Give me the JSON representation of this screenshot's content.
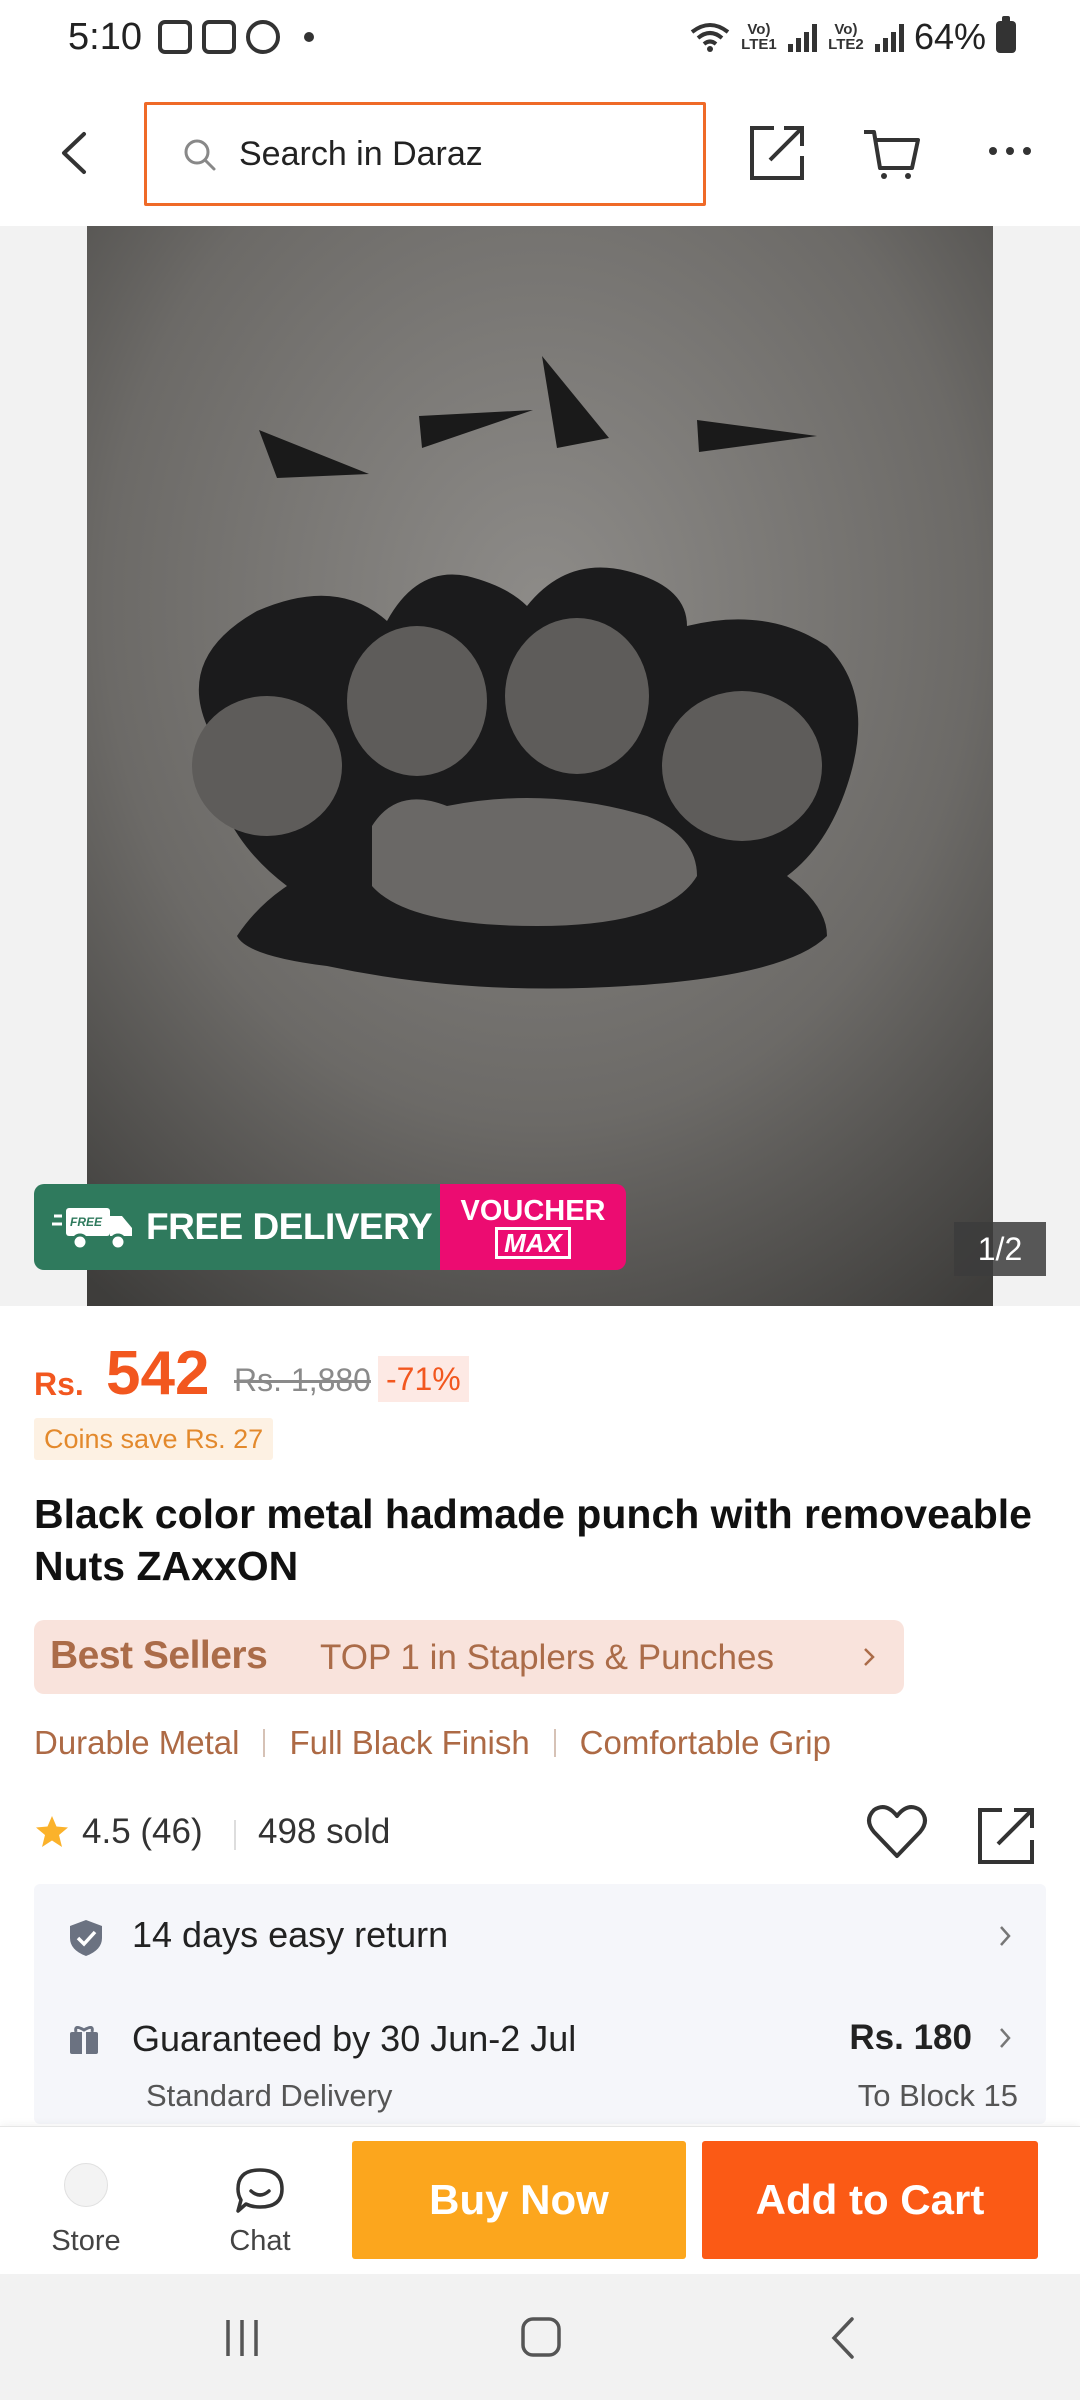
{
  "status_bar": {
    "time": "5:10",
    "lte1": "Vo) LTE1",
    "lte2": "Vo) LTE2",
    "battery": "64%"
  },
  "header": {
    "search_placeholder": "Search in Daraz",
    "icons": [
      "back-icon",
      "search-icon",
      "share-icon",
      "cart-icon",
      "more-icon"
    ]
  },
  "gallery": {
    "counter": "1/2",
    "promo": {
      "free_delivery": "FREE DELIVERY",
      "voucher_line1": "VOUCHER",
      "voucher_line2": "MAX"
    }
  },
  "price": {
    "currency": "Rs.",
    "current": "542",
    "original": "Rs. 1,880",
    "discount": "-71%",
    "coins_save": "Coins save Rs. 27"
  },
  "product": {
    "title": "Black color metal hadmade punch with removeable Nuts ZAxxON"
  },
  "bestsellers": {
    "logo": "Best Sellers",
    "rank": "TOP 1 in Staplers & Punches"
  },
  "features": [
    "Durable Metal",
    "Full Black Finish",
    "Comfortable Grip"
  ],
  "rating": {
    "score_text": "4.5 (46)",
    "sold": "498 sold"
  },
  "services": {
    "return": "14 days easy return",
    "guarantee": "Guaranteed by 30 Jun-2 Jul",
    "delivery_fee": "Rs. 180",
    "delivery_type": "Standard Delivery",
    "delivery_to": "To Block 15"
  },
  "bottom_bar": {
    "store": "Store",
    "chat": "Chat",
    "buy_now": "Buy Now",
    "add_to_cart": "Add to Cart"
  },
  "colors": {
    "accent_orange": "#f2571f",
    "buy_now": "#fca61d",
    "add_to_cart": "#fb5a15",
    "free_delivery_green": "#2f7a5d",
    "voucher_pink": "#ec0c71",
    "bestseller_brown": "#ab6c49"
  }
}
